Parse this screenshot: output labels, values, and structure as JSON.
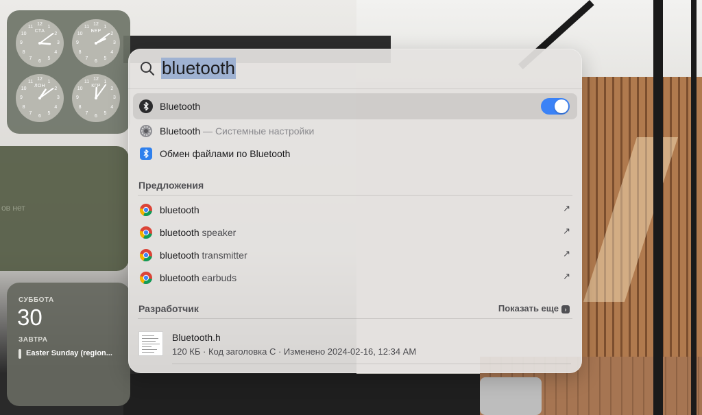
{
  "widgets": {
    "world_clock": {
      "clocks": [
        {
          "city": "СТА",
          "hour": 3,
          "minute": 9
        },
        {
          "city": "БЕР",
          "hour": 2,
          "minute": 9
        },
        {
          "city": "ЛОН",
          "hour": 1,
          "minute": 9
        },
        {
          "city": "КГР",
          "hour": 12,
          "minute": 6
        }
      ]
    },
    "reminders": {
      "text": "ов нет"
    },
    "calendar": {
      "weekday": "СУББОТА",
      "date": "30",
      "tomorrow_label": "ЗАВТРА",
      "event": "Easter Sunday (region..."
    }
  },
  "spotlight": {
    "query": "bluetooth",
    "top_results": [
      {
        "label": "Bluetooth",
        "icon": "bluetooth-dark-icon",
        "toggle": true,
        "selected": true
      },
      {
        "label": "Bluetooth",
        "sub": " — Системные настройки",
        "icon": "system-settings-icon"
      },
      {
        "label": "Обмен файлами по Bluetooth",
        "icon": "bluetooth-file-exchange-icon"
      }
    ],
    "suggestions": {
      "title": "Предложения",
      "items": [
        {
          "bold": "bluetooth",
          "rest": ""
        },
        {
          "bold": "bluetooth",
          "rest": " speaker"
        },
        {
          "bold": "bluetooth",
          "rest": " transmitter"
        },
        {
          "bold": "bluetooth",
          "rest": " earbuds"
        }
      ],
      "arrow": "↗"
    },
    "developer": {
      "title": "Разработчик",
      "show_more": "Показать еще",
      "file_name": "Bluetooth.h",
      "file_meta": "120 КБ · Код заголовка C · Изменено 2024-02-16, 12:34 AM"
    }
  },
  "colors": {
    "accent_toggle": "#3b82f6",
    "selection_highlight": "#9fb2d2"
  }
}
